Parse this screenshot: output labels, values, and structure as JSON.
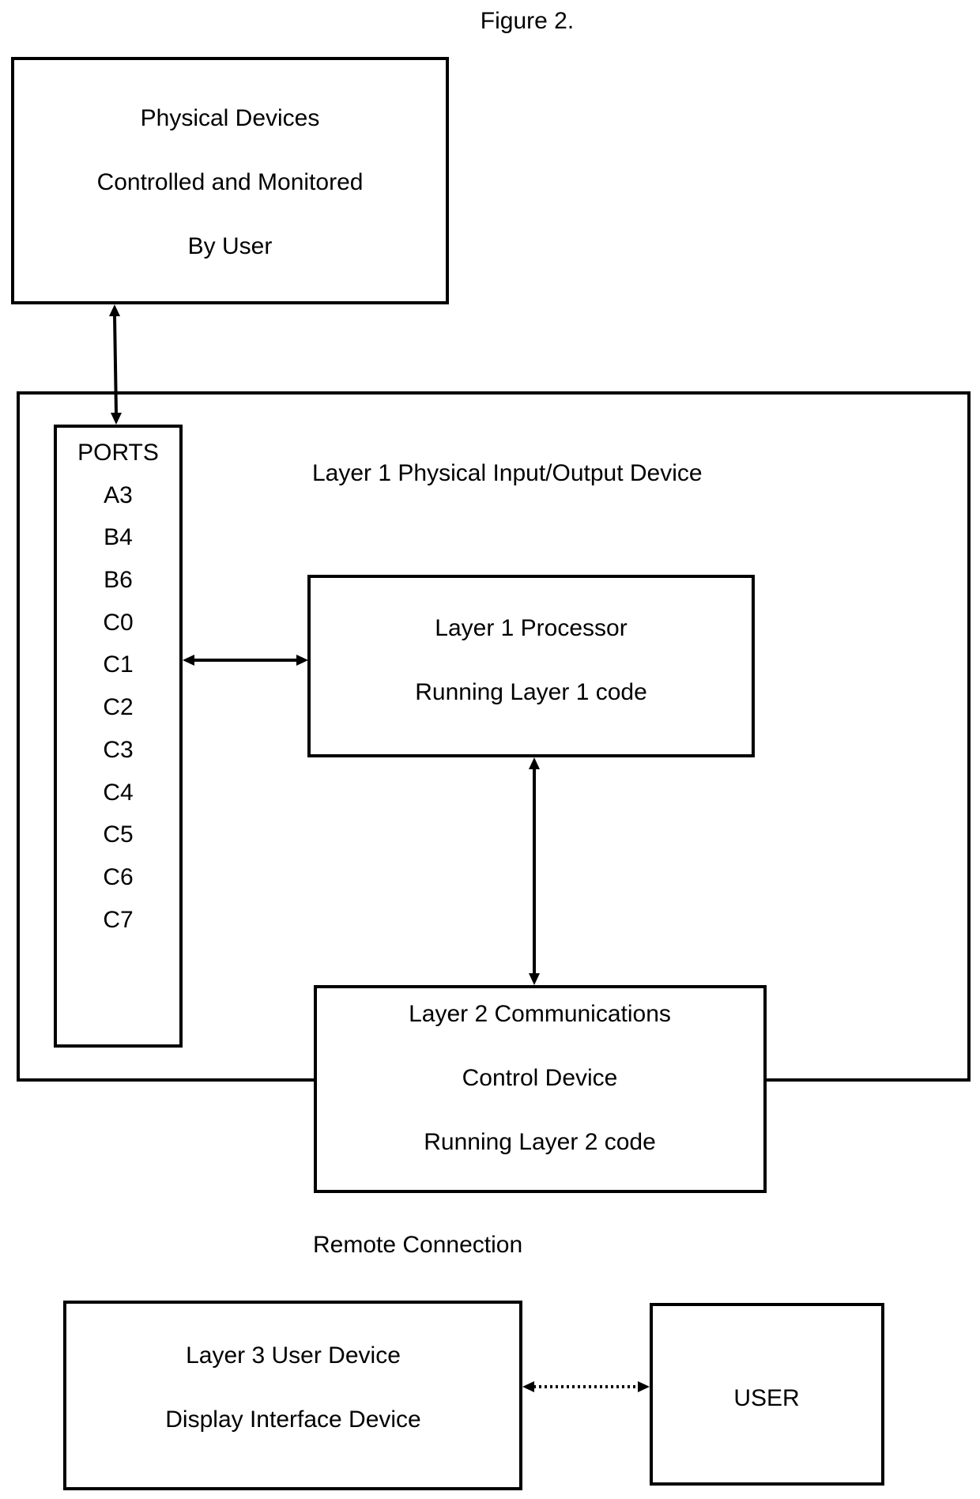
{
  "figure_title": "Figure 2.",
  "colors": {
    "stroke": "#000000",
    "background": "#ffffff",
    "text": "#000000"
  },
  "physical_devices": {
    "lines": [
      "Physical Devices",
      "Controlled and Monitored",
      "By User"
    ]
  },
  "layer1_device": {
    "label": "Layer 1 Physical Input/Output Device"
  },
  "ports": {
    "title": "PORTS",
    "items": [
      "A3",
      "B4",
      "B6",
      "C0",
      "C1",
      "C2",
      "C3",
      "C4",
      "C5",
      "C6",
      "C7"
    ]
  },
  "processor": {
    "lines": [
      "Layer 1 Processor",
      "Running Layer 1 code"
    ]
  },
  "layer2": {
    "lines": [
      "Layer 2 Communications",
      "Control Device",
      "Running Layer 2 code"
    ]
  },
  "remote_connection": "Remote Connection",
  "layer3": {
    "lines": [
      "Layer 3 User Device",
      "Display Interface Device"
    ]
  },
  "user": {
    "label": "USER"
  },
  "connections": [
    {
      "from": "physical-devices",
      "to": "ports",
      "style": "solid",
      "direction": "bidirectional"
    },
    {
      "from": "ports",
      "to": "layer1-processor",
      "style": "solid",
      "direction": "bidirectional"
    },
    {
      "from": "layer1-processor",
      "to": "layer2-communications",
      "style": "solid",
      "direction": "bidirectional"
    },
    {
      "from": "layer3-user-device",
      "to": "user",
      "style": "dotted",
      "direction": "bidirectional"
    }
  ]
}
